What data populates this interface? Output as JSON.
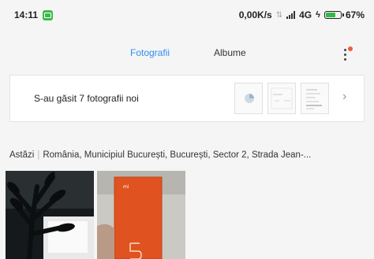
{
  "status_bar": {
    "time": "14:11",
    "speed": "0,00K/s",
    "network": "4G",
    "battery_percent": "67%",
    "battery_level": 0.67,
    "battery_color": "#35b84a"
  },
  "tabs": [
    {
      "label": "Fotografii",
      "active": true,
      "color": "#2f8ff2"
    },
    {
      "label": "Albume",
      "active": false
    }
  ],
  "banner": {
    "text": "S-au găsit 7 fotografii noi"
  },
  "section": {
    "date": "Astăzi",
    "location": "România, Municipiul București, București, Sector 2, Strada Jean-..."
  },
  "photos": [
    {
      "name": "photo-plant",
      "icon": "plant-photo"
    },
    {
      "name": "photo-phone-box",
      "icon": "phone-box-photo"
    }
  ]
}
